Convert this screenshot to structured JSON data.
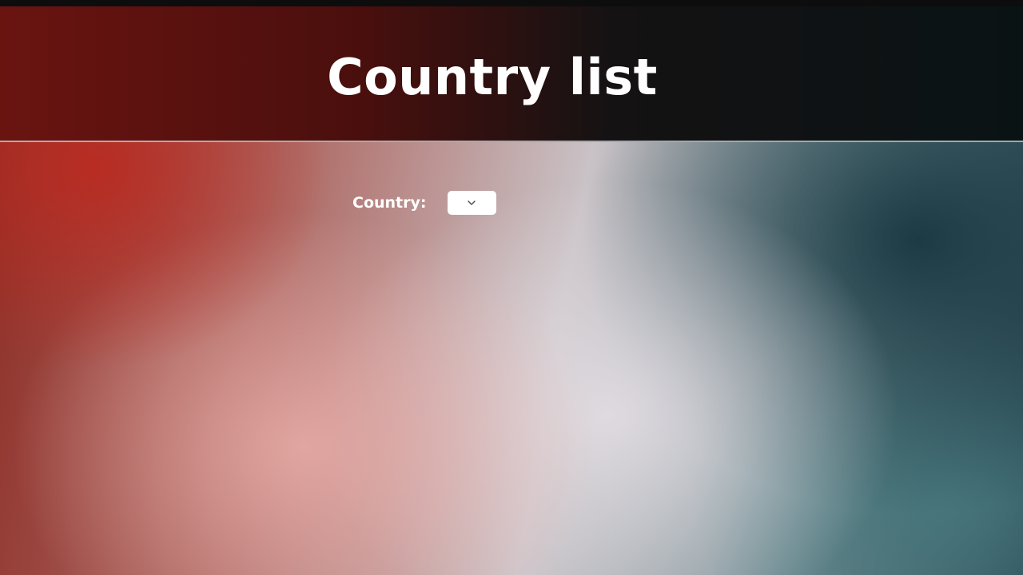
{
  "header": {
    "title": "Country list"
  },
  "form": {
    "country_label": "Country:",
    "country_select_value": "",
    "country_select_icon": "chevron-down-icon"
  },
  "colors": {
    "header_text": "#ffffff",
    "select_background": "#ffffff"
  }
}
